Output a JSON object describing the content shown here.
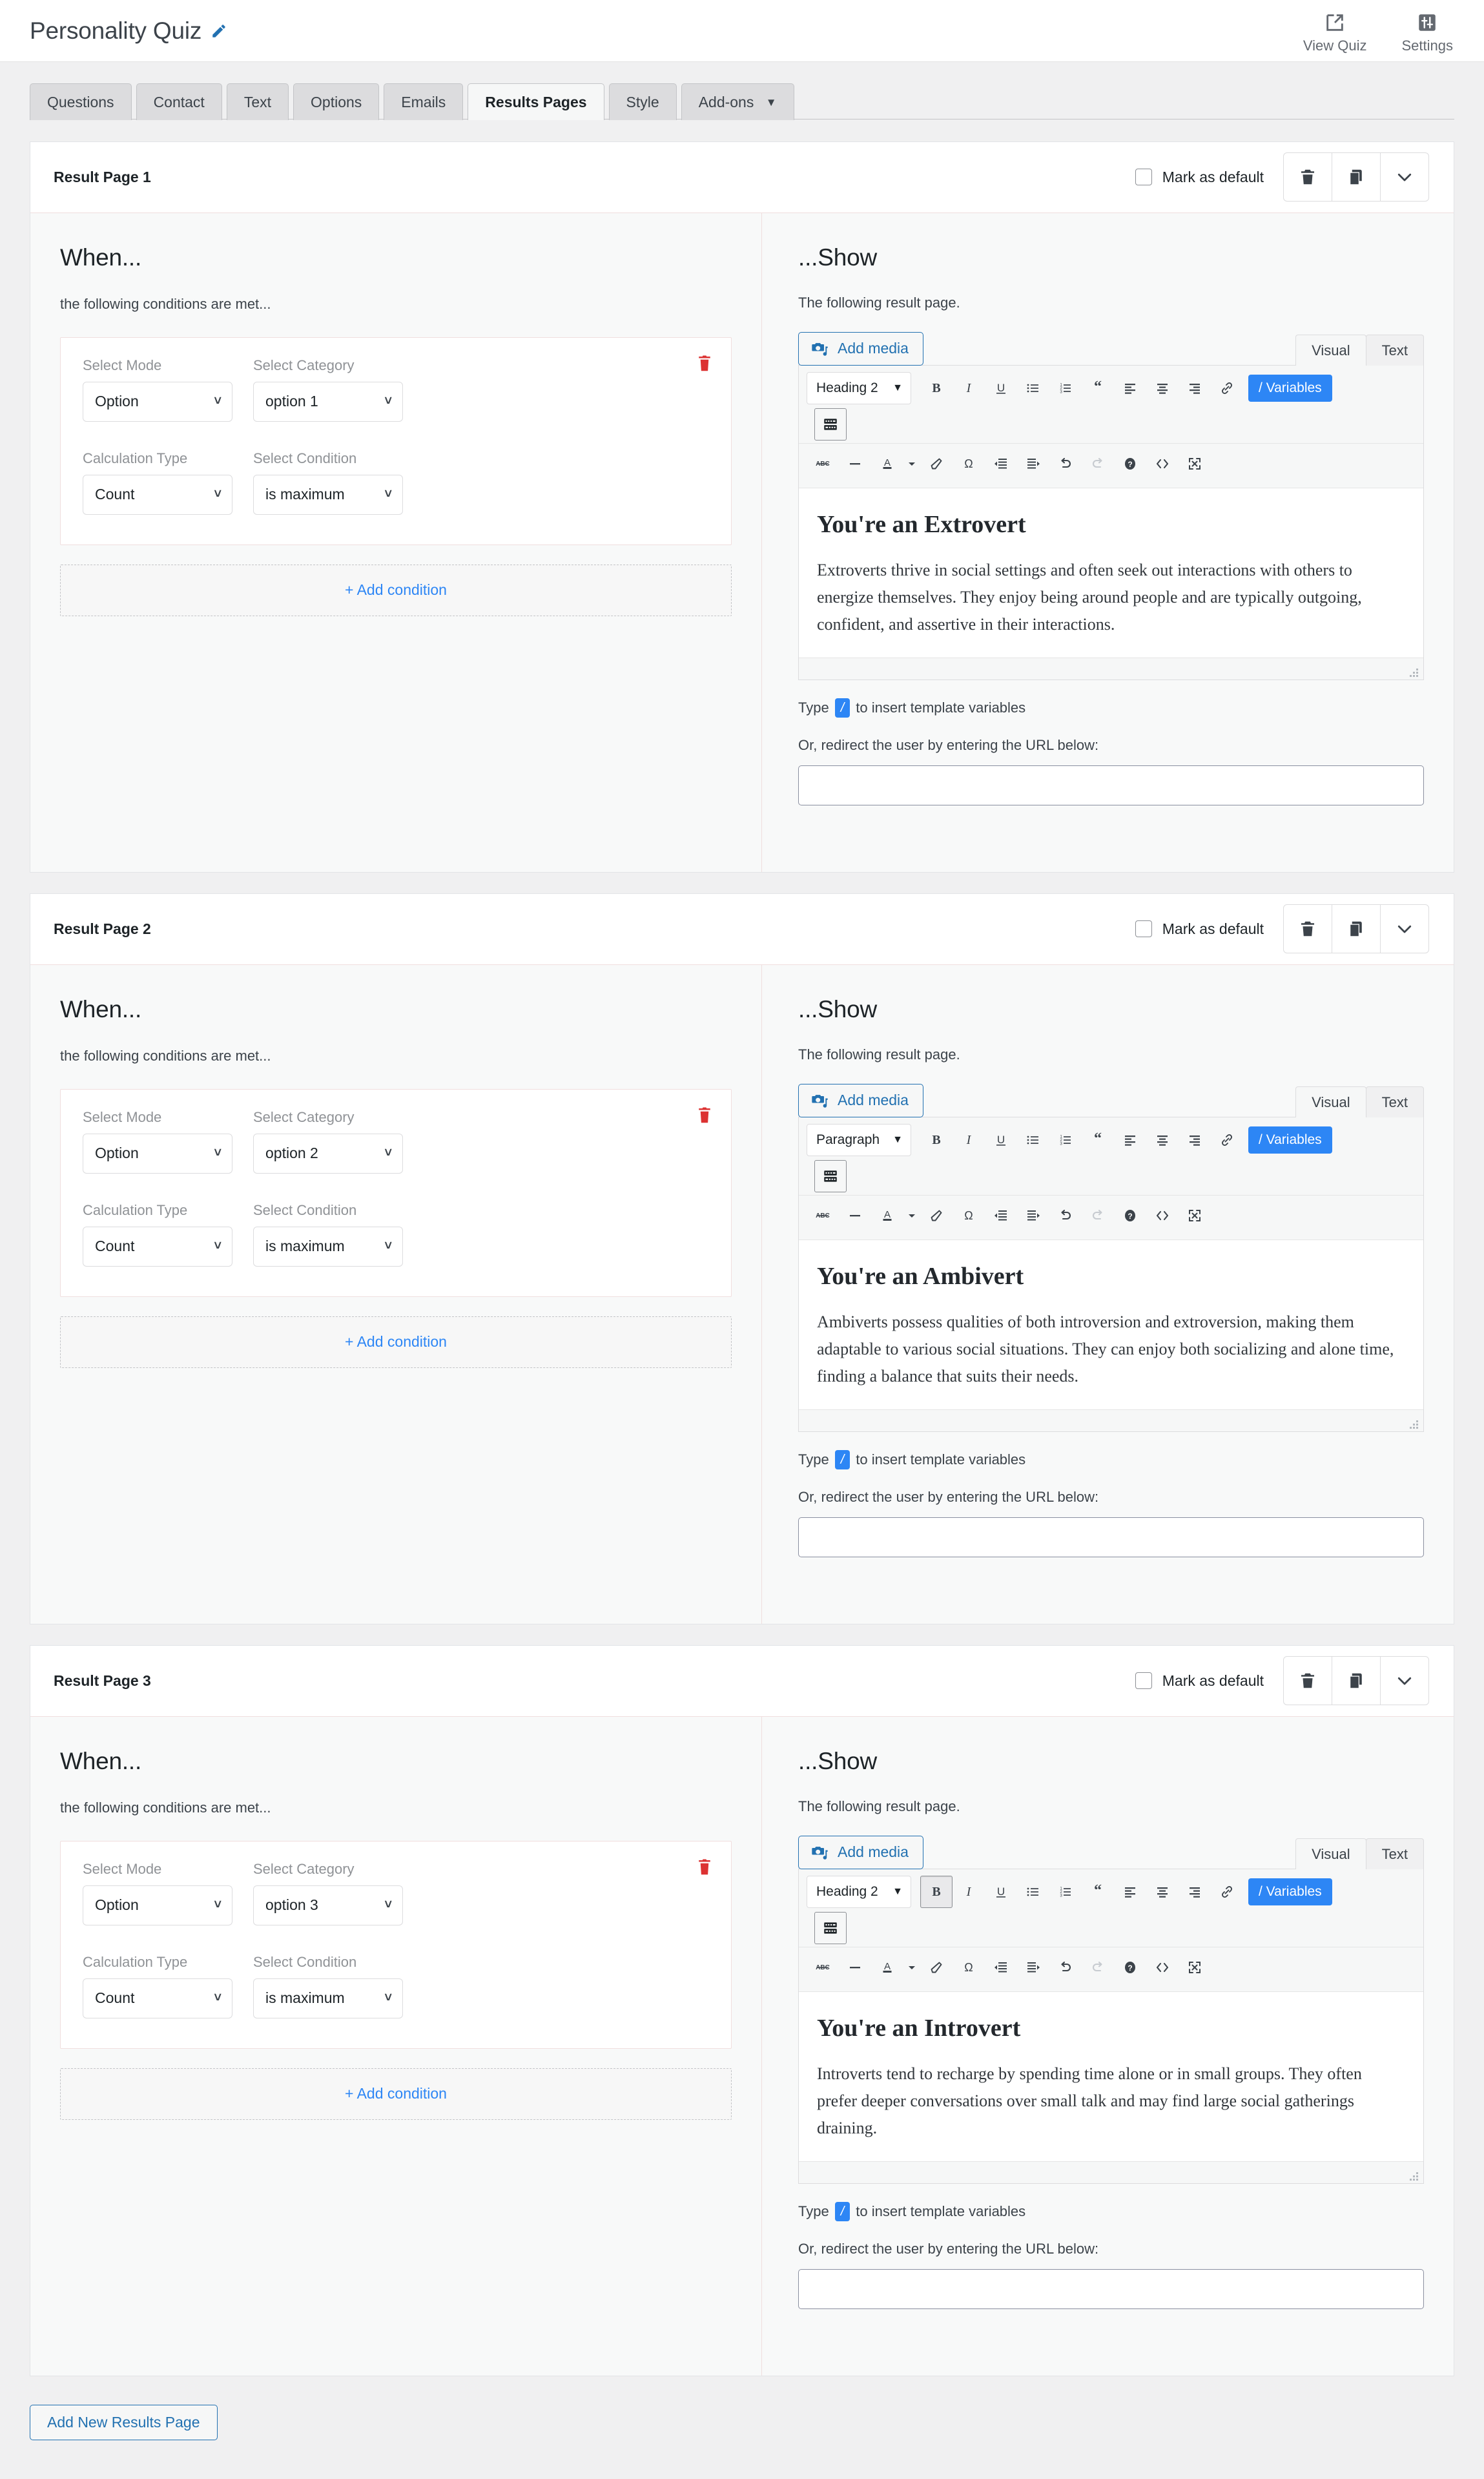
{
  "header": {
    "quiz_title": "Personality Quiz",
    "edit_icon": "pencil-icon",
    "actions": [
      {
        "label": "View Quiz",
        "icon": "external-link-icon"
      },
      {
        "label": "Settings",
        "icon": "sliders-icon"
      }
    ]
  },
  "tabs": [
    {
      "label": "Questions",
      "active": false
    },
    {
      "label": "Contact",
      "active": false
    },
    {
      "label": "Text",
      "active": false
    },
    {
      "label": "Options",
      "active": false
    },
    {
      "label": "Emails",
      "active": false
    },
    {
      "label": "Results Pages",
      "active": true
    },
    {
      "label": "Style",
      "active": false
    },
    {
      "label": "Add-ons",
      "active": false,
      "caret": "▼"
    }
  ],
  "common": {
    "mark_as_default": "Mark as default",
    "when_heading": "When...",
    "when_sub": "the following conditions are met...",
    "show_heading": "...Show",
    "show_sub": "The following result page.",
    "add_condition": "+ Add condition",
    "add_media": "Add media",
    "visual_tab": "Visual",
    "text_tab": "Text",
    "variables_button": "/ Variables",
    "hint_prefix": "Type",
    "hint_chip": "/",
    "hint_suffix": "to insert template variables",
    "redirect_label": "Or, redirect the user by entering the URL below:",
    "url_value": "",
    "url_placeholder": "",
    "labels": {
      "select_mode": "Select Mode",
      "select_category": "Select Category",
      "calculation_type": "Calculation Type",
      "select_condition": "Select Condition"
    },
    "toolbar_icons": [
      "bold-icon",
      "italic-icon",
      "underline-icon",
      "bulleted-list-icon",
      "numbered-list-icon",
      "blockquote-icon",
      "align-left-icon",
      "align-center-icon",
      "align-right-icon",
      "link-icon"
    ],
    "toolbar_icons_row2": [
      "strikethrough-icon",
      "horizontal-rule-icon",
      "text-color-icon",
      "clear-formatting-icon",
      "special-character-icon",
      "outdent-icon",
      "indent-icon",
      "undo-icon",
      "redo-icon",
      "help-icon",
      "source-code-icon",
      "fullscreen-icon"
    ],
    "keyboard_toggle_icon": "keyboard-toolbar-icon",
    "delete_icon": "trash-icon",
    "duplicate_icon": "copy-icon",
    "collapse_icon": "chevron-down-icon",
    "condition_delete_icon": "trash-red-icon"
  },
  "result_pages": [
    {
      "title": "Result Page 1",
      "mark_default_checked": false,
      "condition": {
        "mode": "Option",
        "category": "option 1",
        "calculation": "Count",
        "condition": "is maximum"
      },
      "editor": {
        "format": "Heading 2",
        "bold_active": false,
        "heading": "You're an Extrovert",
        "body": "Extroverts thrive in social settings and often seek out interactions with others to energize themselves. They enjoy being around people and are typically outgoing, confident, and assertive in their interactions."
      }
    },
    {
      "title": "Result Page 2",
      "mark_default_checked": false,
      "condition": {
        "mode": "Option",
        "category": "option 2",
        "calculation": "Count",
        "condition": "is maximum"
      },
      "editor": {
        "format": "Paragraph",
        "bold_active": false,
        "heading": "You're an Ambivert",
        "body": "Ambiverts possess qualities of both introversion and extroversion, making them adaptable to various social situations. They can enjoy both socializing and alone time, finding a balance that suits their needs."
      }
    },
    {
      "title": "Result Page 3",
      "mark_default_checked": false,
      "condition": {
        "mode": "Option",
        "category": "option 3",
        "calculation": "Count",
        "condition": "is maximum"
      },
      "editor": {
        "format": "Heading 2",
        "bold_active": true,
        "heading": "You're an Introvert",
        "body": "Introverts tend to recharge by spending time alone or in small groups. They often prefer deeper conversations over small talk and may find large social gatherings draining."
      }
    }
  ],
  "footer": {
    "add_new_results_page": "Add New Results Page"
  },
  "colors": {
    "accent_blue": "#2d86f5",
    "link_blue": "#2271b1",
    "danger_red": "#dc3232",
    "page_bg": "#f0f0f1",
    "panel_bg": "#f8f9f9",
    "divider_rose": "#f0dede"
  }
}
